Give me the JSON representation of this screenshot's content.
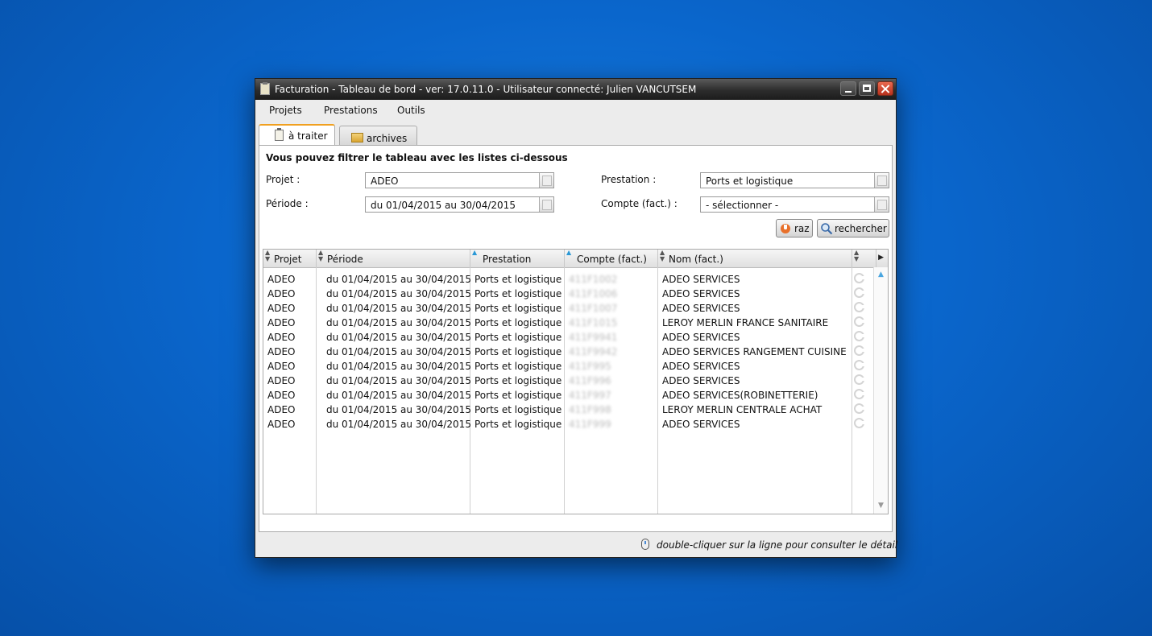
{
  "window": {
    "title": "Facturation - Tableau de bord - ver: 17.0.11.0 - Utilisateur connecté: Julien VANCUTSEM"
  },
  "menu": [
    "Projets",
    "Prestations",
    "Outils"
  ],
  "tabs": [
    {
      "label": "à traiter",
      "icon": "clipboard-icon",
      "active": true
    },
    {
      "label": "archives",
      "icon": "archive-box-icon",
      "active": false
    }
  ],
  "filters": {
    "title": "Vous pouvez filtrer le tableau avec les listes ci-dessous",
    "projet_label": "Projet :",
    "projet_value": "ADEO",
    "periode_label": "Période :",
    "periode_value": "du 01/04/2015 au 30/04/2015",
    "prestation_label": "Prestation :",
    "prestation_value": "Ports et logistique",
    "compte_label": "Compte (fact.) :",
    "compte_value": "- sélectionner -",
    "raz_label": "raz",
    "search_label": "rechercher"
  },
  "table": {
    "headers": [
      "Projet",
      "Période",
      "Prestation",
      "Compte (fact.)",
      "Nom (fact.)"
    ],
    "rows": [
      {
        "projet": "ADEO",
        "periode": "du 01/04/2015 au 30/04/2015",
        "prestation": "Ports et logistique",
        "compte": "411F1002",
        "nom": "ADEO SERVICES"
      },
      {
        "projet": "ADEO",
        "periode": "du 01/04/2015 au 30/04/2015",
        "prestation": "Ports et logistique",
        "compte": "411F1006",
        "nom": "ADEO SERVICES"
      },
      {
        "projet": "ADEO",
        "periode": "du 01/04/2015 au 30/04/2015",
        "prestation": "Ports et logistique",
        "compte": "411F1007",
        "nom": "ADEO SERVICES"
      },
      {
        "projet": "ADEO",
        "periode": "du 01/04/2015 au 30/04/2015",
        "prestation": "Ports et logistique",
        "compte": "411F1015",
        "nom": "LEROY MERLIN FRANCE SANITAIRE"
      },
      {
        "projet": "ADEO",
        "periode": "du 01/04/2015 au 30/04/2015",
        "prestation": "Ports et logistique",
        "compte": "411F9941",
        "nom": "ADEO SERVICES"
      },
      {
        "projet": "ADEO",
        "periode": "du 01/04/2015 au 30/04/2015",
        "prestation": "Ports et logistique",
        "compte": "411F9942",
        "nom": "ADEO SERVICES RANGEMENT CUISINE"
      },
      {
        "projet": "ADEO",
        "periode": "du 01/04/2015 au 30/04/2015",
        "prestation": "Ports et logistique",
        "compte": "411F995",
        "nom": "ADEO SERVICES"
      },
      {
        "projet": "ADEO",
        "periode": "du 01/04/2015 au 30/04/2015",
        "prestation": "Ports et logistique",
        "compte": "411F996",
        "nom": "ADEO SERVICES"
      },
      {
        "projet": "ADEO",
        "periode": "du 01/04/2015 au 30/04/2015",
        "prestation": "Ports et logistique",
        "compte": "411F997",
        "nom": "ADEO SERVICES(ROBINETTERIE)"
      },
      {
        "projet": "ADEO",
        "periode": "du 01/04/2015 au 30/04/2015",
        "prestation": "Ports et logistique",
        "compte": "411F998",
        "nom": "LEROY MERLIN CENTRALE ACHAT"
      },
      {
        "projet": "ADEO",
        "periode": "du 01/04/2015 au 30/04/2015",
        "prestation": "Ports et logistique",
        "compte": "411F999",
        "nom": "ADEO SERVICES"
      }
    ]
  },
  "status": {
    "hint": "double-cliquer sur la ligne pour consulter le détail",
    "icon": "mouse-icon"
  }
}
